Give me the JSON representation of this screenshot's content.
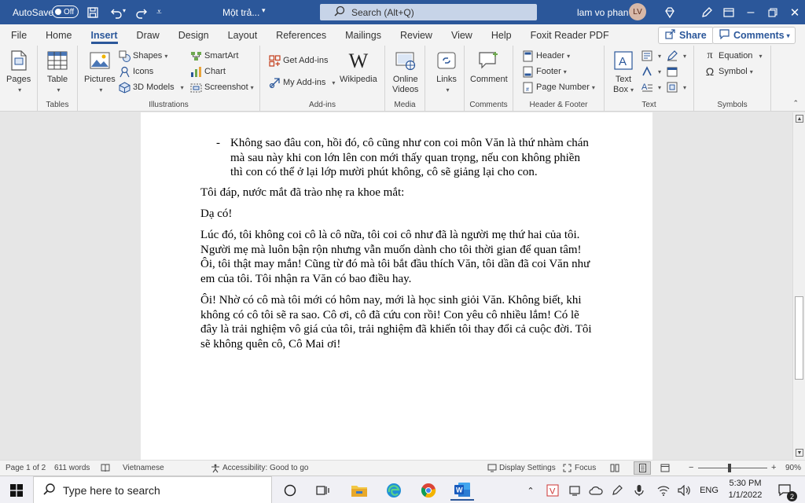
{
  "titlebar": {
    "autosave_label": "AutoSave",
    "autosave_state": "Off",
    "doc_title": "Một trả...",
    "search_placeholder": "Search (Alt+Q)",
    "user_name": "lam vo phan",
    "user_initials": "LV"
  },
  "tabs": [
    "File",
    "Home",
    "Insert",
    "Draw",
    "Design",
    "Layout",
    "References",
    "Mailings",
    "Review",
    "View",
    "Help",
    "Foxit Reader PDF"
  ],
  "active_tab": "Insert",
  "actions": {
    "share": "Share",
    "comments": "Comments"
  },
  "ribbon": {
    "pages": "Pages",
    "table": "Table",
    "tables_group": "Tables",
    "pictures": "Pictures",
    "shapes": "Shapes",
    "icons": "Icons",
    "models3d": "3D Models",
    "smartart": "SmartArt",
    "chart": "Chart",
    "screenshot": "Screenshot",
    "illustrations_group": "Illustrations",
    "get_addins": "Get Add-ins",
    "my_addins": "My Add-ins",
    "wikipedia": "Wikipedia",
    "addins_group": "Add-ins",
    "online_videos_1": "Online",
    "online_videos_2": "Videos",
    "media_group": "Media",
    "links": "Links",
    "comment": "Comment",
    "comments_group": "Comments",
    "header": "Header",
    "footer": "Footer",
    "page_number": "Page Number",
    "header_footer_group": "Header & Footer",
    "textbox_1": "Text",
    "textbox_2": "Box",
    "text_group": "Text",
    "equation": "Equation",
    "symbol": "Symbol",
    "symbols_group": "Symbols"
  },
  "document": {
    "bullet_dash": "-",
    "bullet_lines": [
      "Không sao đâu con, hồi đó, cô cũng như con coi môn Văn là thứ nhàm chán",
      "mà sau này khi con lớn lên con mới thấy quan trọng, nếu con không phiền",
      "thì con có thể ở lại lớp mười phút không, cô sẽ giảng lại cho con."
    ],
    "para1": "Tôi đáp, nước mắt đã trào nhẹ ra khoe mắt:",
    "para2": "Dạ có!",
    "para3_lines": [
      "Lúc đó, tôi không coi cô là cô nữa, tôi coi cô như đã là người mẹ thứ hai của tôi.",
      "Người mẹ mà luôn bận rộn nhưng vẫn muốn dành cho tôi thời gian để quan tâm!",
      "Ôi, tôi thật may mắn! Cũng từ đó mà tôi bắt đầu thích Văn, tôi dần đã coi Văn như",
      "em của tôi. Tôi nhận ra Văn có bao điều hay."
    ],
    "para4_lines": [
      "Ôi! Nhờ có cô mà tôi mới có hôm nay, mới là học sinh giỏi Văn. Không biết, khi",
      "không có cô tôi sẽ ra sao. Cô ơi, cô đã cứu con rồi! Con yêu cô nhiều lắm! Có lẽ",
      "đây là trải nghiệm vô giá của tôi, trải nghiệm đã khiến tôi thay đổi cả cuộc đời. Tôi",
      "sẽ không quên cô, Cô Mai ơi!"
    ]
  },
  "statusbar": {
    "page": "Page 1 of 2",
    "words": "611 words",
    "language": "Vietnamese",
    "accessibility": "Accessibility: Good to go",
    "display_settings": "Display Settings",
    "focus": "Focus",
    "zoom_minus": "−",
    "zoom_plus": "+",
    "zoom": "90%"
  },
  "taskbar": {
    "search_placeholder": "Type here to search",
    "lang": "ENG",
    "time": "5:30 PM",
    "date": "1/1/2022",
    "notification_count": "2"
  },
  "colors": {
    "word_blue": "#2b579a",
    "ribbon_bg": "#f3f3f3",
    "page_bg": "#ffffff"
  }
}
